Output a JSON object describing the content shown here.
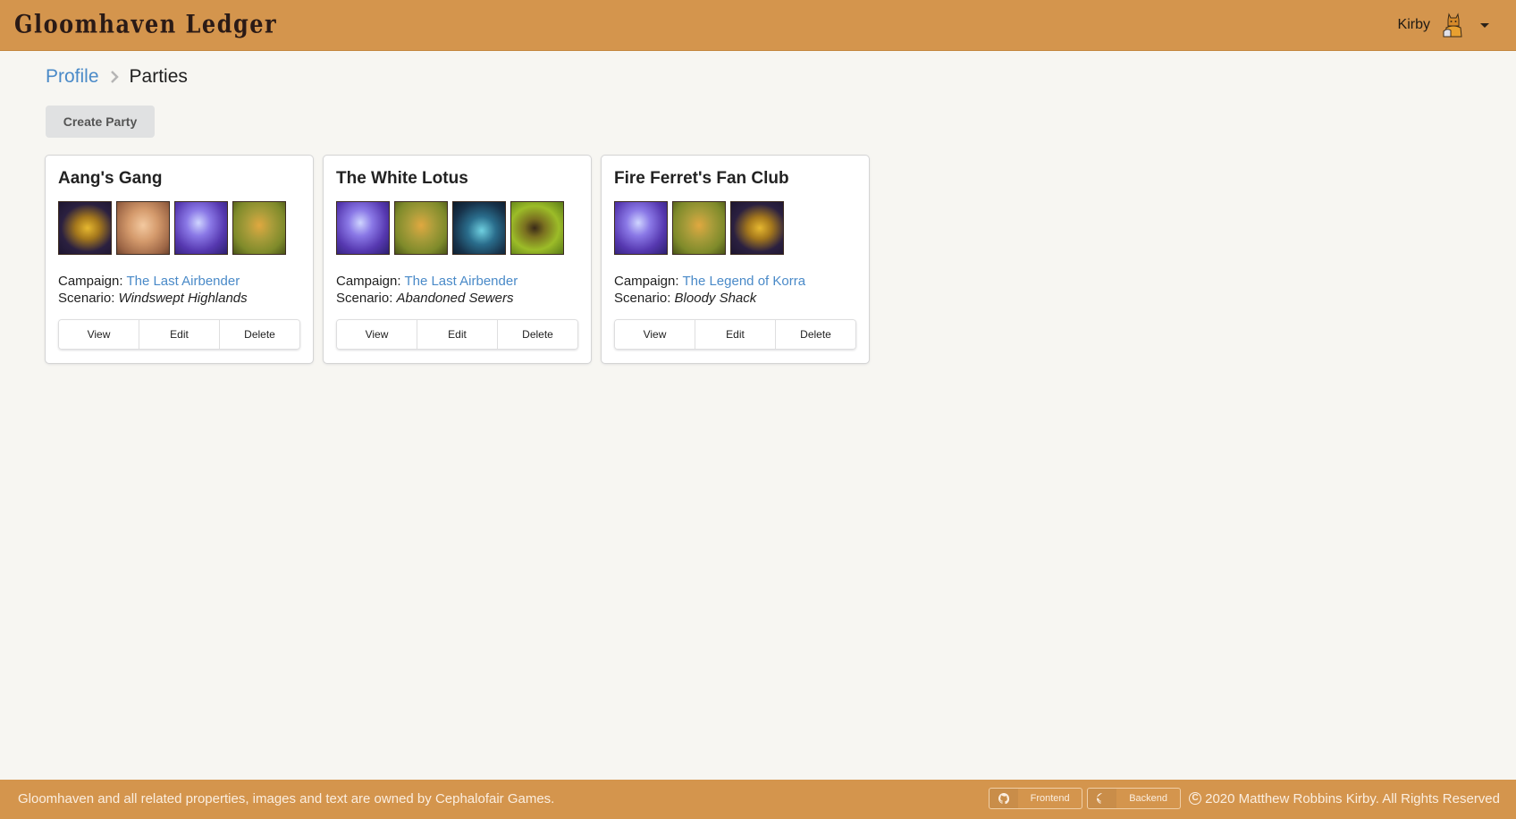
{
  "header": {
    "brand": "Gloomhaven Ledger",
    "user": {
      "name": "Kirby",
      "avatar_icon": "character-avatar-icon",
      "menu_icon": "caret-down-icon"
    }
  },
  "breadcrumb": {
    "items": [
      {
        "label": "Profile",
        "link": true
      },
      {
        "label": "Parties",
        "link": false
      }
    ],
    "separator_icon": "chevron-right-icon"
  },
  "actions": {
    "create_party": "Create Party"
  },
  "parties": [
    {
      "name": "Aang's Gang",
      "portraits": [
        "gold",
        "tan",
        "violet",
        "olive"
      ],
      "campaign_label": "Campaign:",
      "campaign": "The Last Airbender",
      "scenario_label": "Scenario:",
      "scenario": "Windswept Highlands",
      "buttons": {
        "view": "View",
        "edit": "Edit",
        "delete": "Delete"
      }
    },
    {
      "name": "The White Lotus",
      "portraits": [
        "violet",
        "olive",
        "blue",
        "green"
      ],
      "campaign_label": "Campaign:",
      "campaign": "The Last Airbender",
      "scenario_label": "Scenario:",
      "scenario": "Abandoned Sewers",
      "buttons": {
        "view": "View",
        "edit": "Edit",
        "delete": "Delete"
      }
    },
    {
      "name": "Fire Ferret's Fan Club",
      "portraits": [
        "violet",
        "olive",
        "gold"
      ],
      "campaign_label": "Campaign:",
      "campaign": "The Legend of Korra",
      "scenario_label": "Scenario:",
      "scenario": "Bloody Shack",
      "buttons": {
        "view": "View",
        "edit": "Edit",
        "delete": "Delete"
      }
    }
  ],
  "footer": {
    "note": "Gloomhaven and all related properties, images and text are owned by Cephalofair Games.",
    "links": [
      {
        "label": "Frontend",
        "icon": "github-icon"
      },
      {
        "label": "Backend",
        "icon": "github-icon"
      }
    ],
    "copyright": "2020 Matthew Robbins Kirby. All Rights Reserved"
  },
  "colors": {
    "header_bg": "#d4954d",
    "page_bg": "#f7f6f2",
    "link": "#4a8ac8"
  }
}
